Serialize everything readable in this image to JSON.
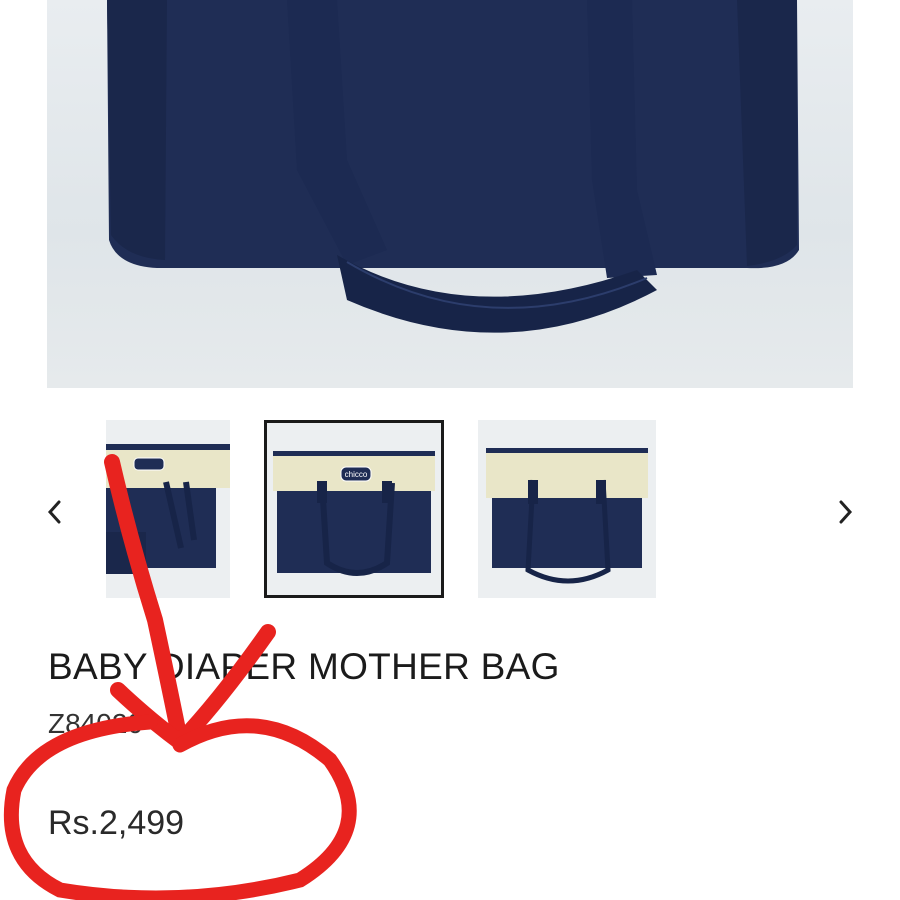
{
  "product": {
    "title": "BABY DIAPER MOTHER BAG",
    "sku": "Z84020",
    "price": "Rs.2,499",
    "brand_label": "chicco"
  },
  "gallery": {
    "thumbnails": [
      {
        "name": "thumb-1"
      },
      {
        "name": "thumb-2"
      },
      {
        "name": "thumb-3"
      }
    ],
    "selected_index": 1,
    "prev_icon": "chevron-left-icon",
    "next_icon": "chevron-right-icon"
  },
  "colors": {
    "bag_navy": "#1f2d55",
    "bag_cream": "#e9e6c8",
    "annotation_red": "#e8231f"
  }
}
